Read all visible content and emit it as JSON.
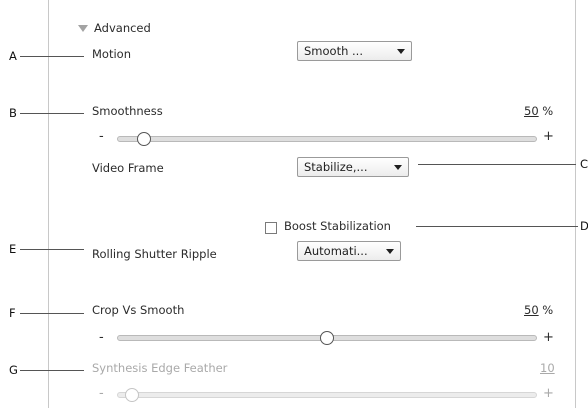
{
  "section": {
    "title": "Advanced"
  },
  "motion": {
    "label": "Motion",
    "value": "Smooth ..."
  },
  "smoothness": {
    "label": "Smoothness",
    "value_num": "50",
    "unit": "%",
    "minus": "-",
    "plus": "+",
    "level": 0.05
  },
  "video_frame": {
    "label": "Video Frame",
    "value": "Stabilize,..."
  },
  "boost": {
    "label": "Boost Stabilization",
    "checked": false
  },
  "rolling_shutter": {
    "label": "Rolling Shutter Ripple",
    "value": "Automati..."
  },
  "crop": {
    "label": "Crop Vs Smooth",
    "value_num": "50",
    "unit": "%",
    "minus": "-",
    "plus": "+",
    "level": 0.5
  },
  "synthesis": {
    "label": "Synthesis Edge Feather",
    "value_num": "10",
    "minus": "-",
    "plus": "+",
    "level": 0.02,
    "enabled": false
  },
  "callouts": {
    "a": "A",
    "b": "B",
    "c": "C",
    "d": "D",
    "e": "E",
    "f": "F",
    "g": "G"
  }
}
